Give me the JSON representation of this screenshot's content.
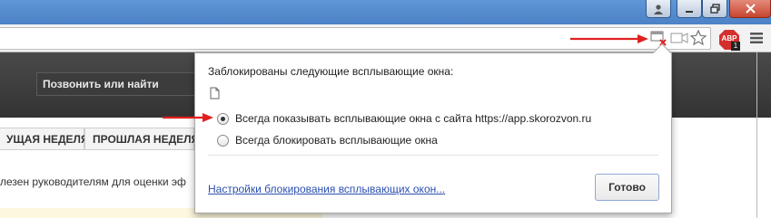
{
  "browser": {
    "window_controls": [
      "user-icon",
      "minimize-icon",
      "restore-icon",
      "close-icon"
    ],
    "toolbar_icons": [
      "popup-blocked-icon",
      "camera-icon",
      "bookmark-star-icon",
      "adblock-plus-icon",
      "menu-icon"
    ],
    "adblock": {
      "label": "ABP",
      "badge": "1"
    }
  },
  "page": {
    "search_placeholder": "Позвонить или найти",
    "tabs": [
      "УЩАЯ НЕДЕЛЯ",
      "ПРОШЛАЯ НЕДЕЛЯ"
    ],
    "body_text": "лезен руководителям для оценки эф"
  },
  "popup": {
    "title": "Заблокированы следующие всплывающие окна:",
    "file_icon": "file-icon",
    "options": [
      {
        "label": "Всегда показывать всплывающие окна с сайта https://app.skorozvon.ru",
        "selected": true
      },
      {
        "label": "Всегда блокировать всплывающие окна",
        "selected": false
      }
    ],
    "settings_link": "Настройки блокирования всплывающих окон...",
    "done_button": "Готово"
  },
  "colors": {
    "title_bar": "#5f96d6",
    "annotation_arrow": "#e0201f",
    "link": "#2a4fb0",
    "adblock_red": "#d32f2f"
  }
}
